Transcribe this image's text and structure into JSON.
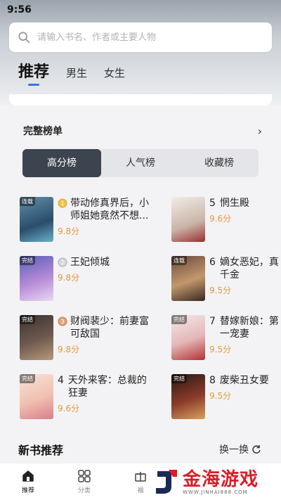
{
  "status_bar": {
    "time": "9:56"
  },
  "search": {
    "placeholder": "请输入书名、作者或主要人物"
  },
  "tabs": [
    {
      "label": "推荐",
      "active": true
    },
    {
      "label": "男生",
      "active": false
    },
    {
      "label": "女生",
      "active": false
    }
  ],
  "ranking": {
    "title": "完整榜单",
    "segments": [
      {
        "label": "高分榜",
        "active": true
      },
      {
        "label": "人气榜",
        "active": false
      },
      {
        "label": "收藏榜",
        "active": false
      }
    ],
    "books": [
      {
        "rank": "1",
        "name": "带动修真界后，小师姐她竟然不想...",
        "score": "9.8分",
        "medal": "gold",
        "tag": "连载"
      },
      {
        "rank": "5",
        "name": "惘生殿",
        "score": "9.6分",
        "medal": "",
        "tag": ""
      },
      {
        "rank": "2",
        "name": "王妃倾城",
        "score": "9.8分",
        "medal": "silver",
        "tag": "完结"
      },
      {
        "rank": "6",
        "name": "嫡女恶妃，真千金",
        "score": "9.5分",
        "medal": "",
        "tag": "连载"
      },
      {
        "rank": "3",
        "name": "财阀裴少：前妻富可敌国",
        "score": "9.8分",
        "medal": "bronze",
        "tag": "完结"
      },
      {
        "rank": "7",
        "name": "替嫁新娘：第一宠妻",
        "score": "9.5分",
        "medal": "",
        "tag": "完结"
      },
      {
        "rank": "4",
        "name": "天外来客：总裁的狂妻",
        "score": "9.6分",
        "medal": "",
        "tag": "完结"
      },
      {
        "rank": "8",
        "name": "废柴丑女要",
        "score": "9.5分",
        "medal": "",
        "tag": "完结"
      }
    ]
  },
  "new_books": {
    "title": "新书推荐",
    "refresh": "换一换"
  },
  "bottom_nav": [
    {
      "label": "推荐",
      "active": true,
      "icon": "home-icon"
    },
    {
      "label": "分类",
      "active": false,
      "icon": "grid-icon"
    },
    {
      "label": "福",
      "active": false,
      "icon": "gift-icon"
    }
  ],
  "watermark": {
    "title": "金海游戏",
    "subtitle": "WWW.JINHAI888.COM"
  },
  "colors": {
    "accent": "#3f6fd8",
    "score": "#e39a3d",
    "segment_active": "#3c4450",
    "watermark": "#d81e2a"
  }
}
